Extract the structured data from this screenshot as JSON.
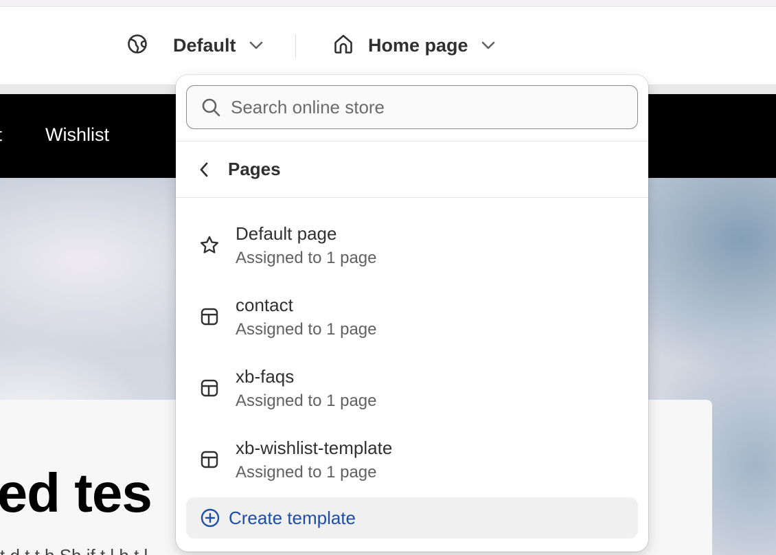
{
  "topbar": {
    "theme_label": "Default",
    "page_label": "Home page",
    "theme_icon": "globe-icon",
    "page_icon": "home-icon"
  },
  "preview": {
    "nav": [
      "ct",
      "Wishlist"
    ],
    "hero_title": "ted tes",
    "hero_text": "t d  t  t    h  Sh  if  t l  h  t  l"
  },
  "dropdown": {
    "search_placeholder": "Search online store",
    "section_title": "Pages",
    "items": [
      {
        "name": "Default page",
        "subtitle": "Assigned to 1 page",
        "icon": "star-icon"
      },
      {
        "name": "contact",
        "subtitle": "Assigned to 1 page",
        "icon": "template-icon"
      },
      {
        "name": "xb-faqs",
        "subtitle": "Assigned to 1 page",
        "icon": "template-icon"
      },
      {
        "name": "xb-wishlist-template",
        "subtitle": "Assigned to 1 page",
        "icon": "template-icon"
      }
    ],
    "create_label": "Create template"
  },
  "colors": {
    "accent": "#1d4ea6",
    "nav_bg": "#000000",
    "text": "#303030",
    "muted": "#616161"
  }
}
